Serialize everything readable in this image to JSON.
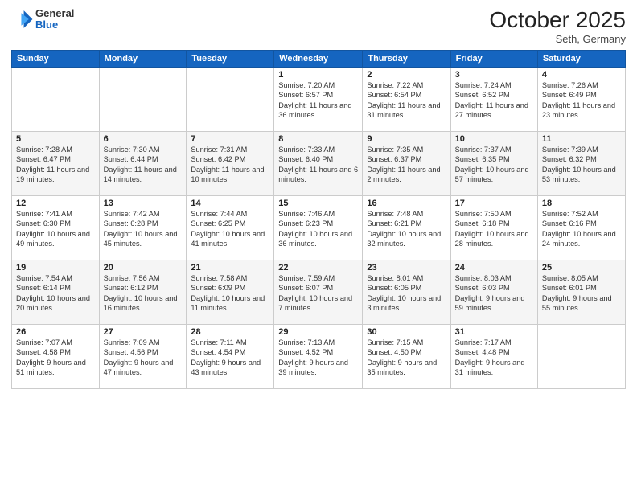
{
  "header": {
    "logo_general": "General",
    "logo_blue": "Blue",
    "month_title": "October 2025",
    "subtitle": "Seth, Germany"
  },
  "days_of_week": [
    "Sunday",
    "Monday",
    "Tuesday",
    "Wednesday",
    "Thursday",
    "Friday",
    "Saturday"
  ],
  "weeks": [
    [
      {
        "day": "",
        "info": ""
      },
      {
        "day": "",
        "info": ""
      },
      {
        "day": "",
        "info": ""
      },
      {
        "day": "1",
        "info": "Sunrise: 7:20 AM\nSunset: 6:57 PM\nDaylight: 11 hours and 36 minutes."
      },
      {
        "day": "2",
        "info": "Sunrise: 7:22 AM\nSunset: 6:54 PM\nDaylight: 11 hours and 31 minutes."
      },
      {
        "day": "3",
        "info": "Sunrise: 7:24 AM\nSunset: 6:52 PM\nDaylight: 11 hours and 27 minutes."
      },
      {
        "day": "4",
        "info": "Sunrise: 7:26 AM\nSunset: 6:49 PM\nDaylight: 11 hours and 23 minutes."
      }
    ],
    [
      {
        "day": "5",
        "info": "Sunrise: 7:28 AM\nSunset: 6:47 PM\nDaylight: 11 hours and 19 minutes."
      },
      {
        "day": "6",
        "info": "Sunrise: 7:30 AM\nSunset: 6:44 PM\nDaylight: 11 hours and 14 minutes."
      },
      {
        "day": "7",
        "info": "Sunrise: 7:31 AM\nSunset: 6:42 PM\nDaylight: 11 hours and 10 minutes."
      },
      {
        "day": "8",
        "info": "Sunrise: 7:33 AM\nSunset: 6:40 PM\nDaylight: 11 hours and 6 minutes."
      },
      {
        "day": "9",
        "info": "Sunrise: 7:35 AM\nSunset: 6:37 PM\nDaylight: 11 hours and 2 minutes."
      },
      {
        "day": "10",
        "info": "Sunrise: 7:37 AM\nSunset: 6:35 PM\nDaylight: 10 hours and 57 minutes."
      },
      {
        "day": "11",
        "info": "Sunrise: 7:39 AM\nSunset: 6:32 PM\nDaylight: 10 hours and 53 minutes."
      }
    ],
    [
      {
        "day": "12",
        "info": "Sunrise: 7:41 AM\nSunset: 6:30 PM\nDaylight: 10 hours and 49 minutes."
      },
      {
        "day": "13",
        "info": "Sunrise: 7:42 AM\nSunset: 6:28 PM\nDaylight: 10 hours and 45 minutes."
      },
      {
        "day": "14",
        "info": "Sunrise: 7:44 AM\nSunset: 6:25 PM\nDaylight: 10 hours and 41 minutes."
      },
      {
        "day": "15",
        "info": "Sunrise: 7:46 AM\nSunset: 6:23 PM\nDaylight: 10 hours and 36 minutes."
      },
      {
        "day": "16",
        "info": "Sunrise: 7:48 AM\nSunset: 6:21 PM\nDaylight: 10 hours and 32 minutes."
      },
      {
        "day": "17",
        "info": "Sunrise: 7:50 AM\nSunset: 6:18 PM\nDaylight: 10 hours and 28 minutes."
      },
      {
        "day": "18",
        "info": "Sunrise: 7:52 AM\nSunset: 6:16 PM\nDaylight: 10 hours and 24 minutes."
      }
    ],
    [
      {
        "day": "19",
        "info": "Sunrise: 7:54 AM\nSunset: 6:14 PM\nDaylight: 10 hours and 20 minutes."
      },
      {
        "day": "20",
        "info": "Sunrise: 7:56 AM\nSunset: 6:12 PM\nDaylight: 10 hours and 16 minutes."
      },
      {
        "day": "21",
        "info": "Sunrise: 7:58 AM\nSunset: 6:09 PM\nDaylight: 10 hours and 11 minutes."
      },
      {
        "day": "22",
        "info": "Sunrise: 7:59 AM\nSunset: 6:07 PM\nDaylight: 10 hours and 7 minutes."
      },
      {
        "day": "23",
        "info": "Sunrise: 8:01 AM\nSunset: 6:05 PM\nDaylight: 10 hours and 3 minutes."
      },
      {
        "day": "24",
        "info": "Sunrise: 8:03 AM\nSunset: 6:03 PM\nDaylight: 9 hours and 59 minutes."
      },
      {
        "day": "25",
        "info": "Sunrise: 8:05 AM\nSunset: 6:01 PM\nDaylight: 9 hours and 55 minutes."
      }
    ],
    [
      {
        "day": "26",
        "info": "Sunrise: 7:07 AM\nSunset: 4:58 PM\nDaylight: 9 hours and 51 minutes."
      },
      {
        "day": "27",
        "info": "Sunrise: 7:09 AM\nSunset: 4:56 PM\nDaylight: 9 hours and 47 minutes."
      },
      {
        "day": "28",
        "info": "Sunrise: 7:11 AM\nSunset: 4:54 PM\nDaylight: 9 hours and 43 minutes."
      },
      {
        "day": "29",
        "info": "Sunrise: 7:13 AM\nSunset: 4:52 PM\nDaylight: 9 hours and 39 minutes."
      },
      {
        "day": "30",
        "info": "Sunrise: 7:15 AM\nSunset: 4:50 PM\nDaylight: 9 hours and 35 minutes."
      },
      {
        "day": "31",
        "info": "Sunrise: 7:17 AM\nSunset: 4:48 PM\nDaylight: 9 hours and 31 minutes."
      },
      {
        "day": "",
        "info": ""
      }
    ]
  ]
}
